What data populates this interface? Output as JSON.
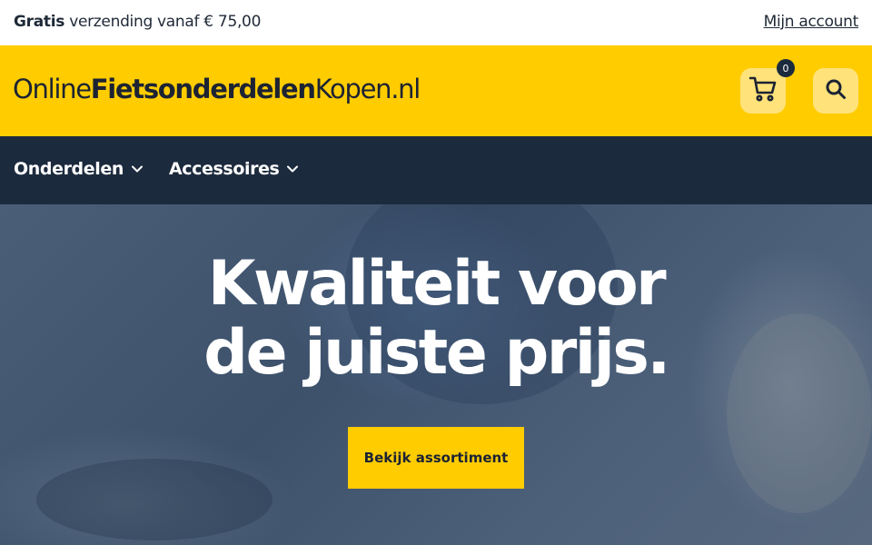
{
  "topbar": {
    "shipping_bold": "Gratis",
    "shipping_rest": " verzending vanaf € 75,00",
    "account_link": "Mijn account"
  },
  "header": {
    "logo_part1": "Online",
    "logo_part2": "Fietsonderdelen",
    "logo_part3": "Kopen.nl",
    "cart_count": "0",
    "cart_icon": "cart-icon",
    "search_icon": "search-icon",
    "accent_color": "#ffcc00"
  },
  "nav": {
    "items": [
      {
        "label": "Onderdelen",
        "icon": "chevron-down-icon"
      },
      {
        "label": "Accessoires",
        "icon": "chevron-down-icon"
      }
    ],
    "background": "#1c2a3d"
  },
  "hero": {
    "title_line1": "Kwaliteit voor",
    "title_line2": "de juiste prijs.",
    "cta_label": "Bekijk assortiment"
  }
}
